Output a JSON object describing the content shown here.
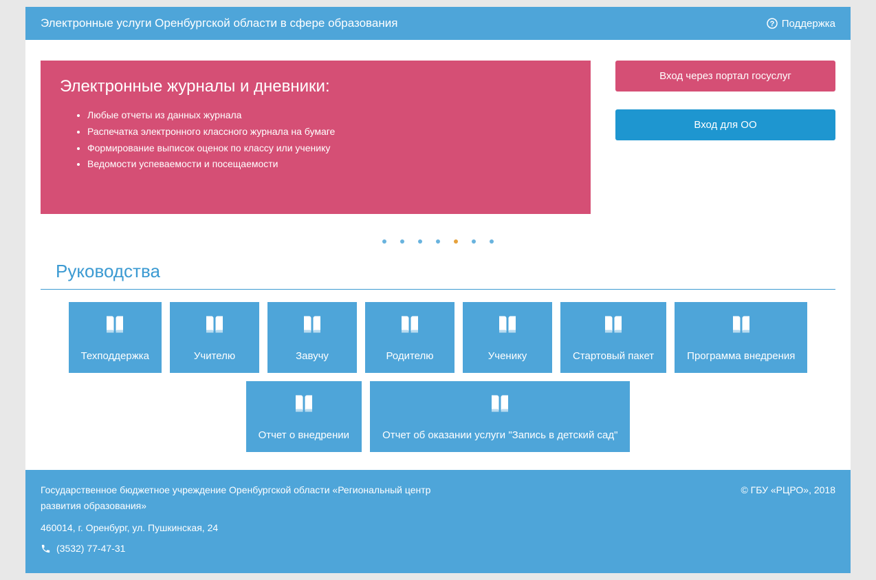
{
  "header": {
    "title": "Электронные услуги Оренбургской области в сфере образования",
    "support": "Поддержка"
  },
  "promo": {
    "title": "Электронные журналы и дневники:",
    "items": [
      "Любые отчеты из данных журнала",
      "Распечатка электронного классного журнала на бумаге",
      "Формирование выписок оценок по классу или ученику",
      "Ведомости успеваемости и посещаемости"
    ]
  },
  "buttons": {
    "gosuslugi": "Вход через портал госуслуг",
    "oo": "Вход для ОО"
  },
  "section": "Руководства",
  "tiles": [
    "Техподдержка",
    "Учителю",
    "Завучу",
    "Родителю",
    "Ученику",
    "Стартовый пакет",
    "Программа внедрения",
    "Отчет о внедрении",
    "Отчет об оказании услуги \"Запись в детский сад\""
  ],
  "footer": {
    "org": "Государственное бюджетное учреждение Оренбургской области «Региональный центр развития образования»",
    "addr": "460014, г. Оренбург, ул. Пушкинская, 24",
    "phone": "(3532) 77-47-31",
    "copy": "© ГБУ «РЦРО», 2018"
  },
  "carousel": {
    "count": 7,
    "active": 4
  }
}
